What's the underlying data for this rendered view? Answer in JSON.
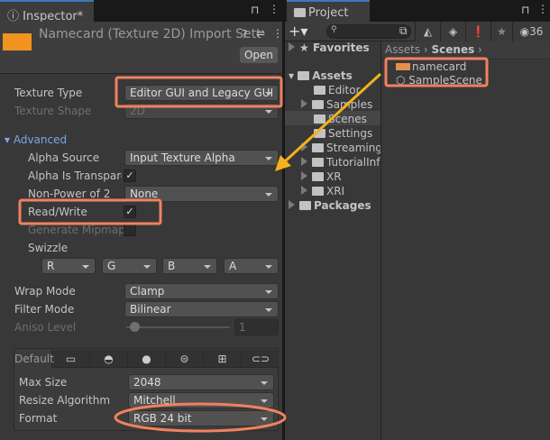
{
  "inspector": {
    "tab_title": "Inspector*",
    "header_title": "Namecard (Texture 2D) Import Sett",
    "open_button": "Open",
    "texture_type": {
      "label": "Texture Type",
      "value": "Editor GUI and Legacy GUI"
    },
    "texture_shape": {
      "label": "Texture Shape",
      "value": "2D"
    },
    "advanced": {
      "label": "Advanced",
      "alpha_source": {
        "label": "Alpha Source",
        "value": "Input Texture Alpha"
      },
      "alpha_is_transparency": {
        "label": "Alpha Is Transpare",
        "checked": true
      },
      "non_power_of_2": {
        "label": "Non-Power of 2",
        "value": "None"
      },
      "read_write": {
        "label": "Read/Write",
        "checked": true
      },
      "generate_mipmap": {
        "label": "Generate Mipmap",
        "checked": false
      },
      "swizzle": {
        "label": "Swizzle",
        "values": [
          "R",
          "G",
          "B",
          "A"
        ]
      }
    },
    "wrap_mode": {
      "label": "Wrap Mode",
      "value": "Clamp"
    },
    "filter_mode": {
      "label": "Filter Mode",
      "value": "Bilinear"
    },
    "aniso_level": {
      "label": "Aniso Level",
      "value": "1"
    },
    "platform_tabs": {
      "default": "Default",
      "icons": [
        "monitor-icon",
        "android-icon",
        "apple-icon",
        "webgl-icon",
        "windows-icon",
        "vr-headset-icon"
      ]
    },
    "max_size": {
      "label": "Max Size",
      "value": "2048"
    },
    "resize_algorithm": {
      "label": "Resize Algorithm",
      "value": "Mitchell"
    },
    "format": {
      "label": "Format",
      "value": "RGB 24 bit"
    }
  },
  "project": {
    "tab_title": "Project",
    "hidden_count": "36",
    "tree": {
      "favorites": "Favorites",
      "assets": "Assets",
      "folders": [
        "Editor",
        "Samples",
        "Scenes",
        "Settings",
        "Streaming",
        "TutorialInf",
        "XR",
        "XRI"
      ],
      "packages": "Packages"
    },
    "breadcrumb": [
      "Assets",
      "Scenes"
    ],
    "items": [
      "namecard",
      "SampleScene"
    ]
  },
  "colors": {
    "annotation": "#f0825f",
    "arrow": "#f2b21a",
    "link": "#7aa9e6"
  }
}
